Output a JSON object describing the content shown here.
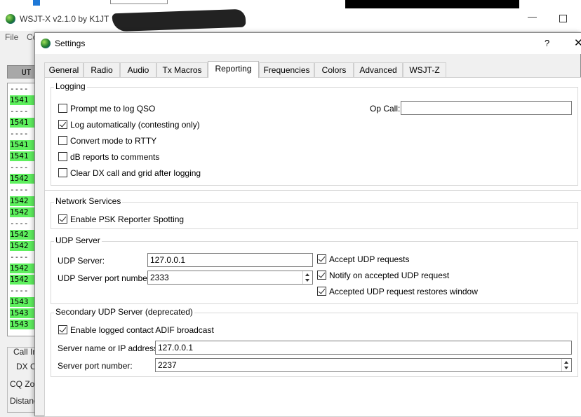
{
  "main_window": {
    "title": "WSJT-X   v2.1.0   by K1JT",
    "menu": [
      "File",
      "Co"
    ],
    "utc_header": "UT",
    "decode_rows": [
      {
        "text": "----",
        "green": false
      },
      {
        "text": "1541",
        "green": true
      },
      {
        "text": "----",
        "green": false
      },
      {
        "text": "1541",
        "green": true
      },
      {
        "text": "----",
        "green": false
      },
      {
        "text": "1541",
        "green": true
      },
      {
        "text": "1541",
        "green": true
      },
      {
        "text": "----",
        "green": false
      },
      {
        "text": "1542",
        "green": true
      },
      {
        "text": "----",
        "green": false
      },
      {
        "text": "1542",
        "green": true
      },
      {
        "text": "1542",
        "green": true
      },
      {
        "text": "----",
        "green": false
      },
      {
        "text": "1542",
        "green": true
      },
      {
        "text": "1542",
        "green": true
      },
      {
        "text": "----",
        "green": false
      },
      {
        "text": "1542",
        "green": true
      },
      {
        "text": "1542",
        "green": true
      },
      {
        "text": "----",
        "green": false
      },
      {
        "text": "1543",
        "green": true
      },
      {
        "text": "1543",
        "green": true
      },
      {
        "text": "1543",
        "green": true
      }
    ],
    "call_labels": [
      "Call In",
      "DX Ca",
      "CQ Zon",
      "Distanc"
    ]
  },
  "dialog": {
    "title": "Settings",
    "help_label": "?",
    "close_label": "✕",
    "tabs": [
      "General",
      "Radio",
      "Audio",
      "Tx Macros",
      "Reporting",
      "Frequencies",
      "Colors",
      "Advanced",
      "WSJT-Z"
    ],
    "active_tab": "Reporting",
    "logging": {
      "title": "Logging",
      "prompt_log_qso": {
        "label": "Prompt me to log QSO",
        "checked": false
      },
      "log_automatically": {
        "label": "Log automatically (contesting only)",
        "checked": true
      },
      "convert_rtty": {
        "label": "Convert mode to RTTY",
        "checked": false
      },
      "db_reports": {
        "label": "dB reports to comments",
        "checked": false
      },
      "clear_dx": {
        "label": "Clear DX call and grid after logging",
        "checked": false
      },
      "op_call_label": "Op Call:",
      "op_call_value": ""
    },
    "network": {
      "title": "Network Services",
      "psk_reporter": {
        "label": "Enable PSK Reporter Spotting",
        "checked": true
      }
    },
    "udp": {
      "title": "UDP Server",
      "server_label": "UDP Server:",
      "server_value": "127.0.0.1",
      "port_label": "UDP Server port number:",
      "port_value": "2333",
      "accept_requests": {
        "label": "Accept UDP requests",
        "checked": true
      },
      "notify_accepted": {
        "label": "Notify on accepted UDP request",
        "checked": true
      },
      "restores_window": {
        "label": "Accepted UDP request restores window",
        "checked": true
      }
    },
    "secondary_udp": {
      "title": "Secondary UDP Server (deprecated)",
      "adif_broadcast": {
        "label": "Enable logged contact ADIF broadcast",
        "checked": true
      },
      "server_label": "Server name or IP address:",
      "server_value": "127.0.0.1",
      "port_label": "Server port number:",
      "port_value": "2237"
    }
  },
  "colors": {
    "decode_green": "#5ef05e",
    "header_gray": "#a8a8a8",
    "accent_blue": "#1e78d7"
  }
}
